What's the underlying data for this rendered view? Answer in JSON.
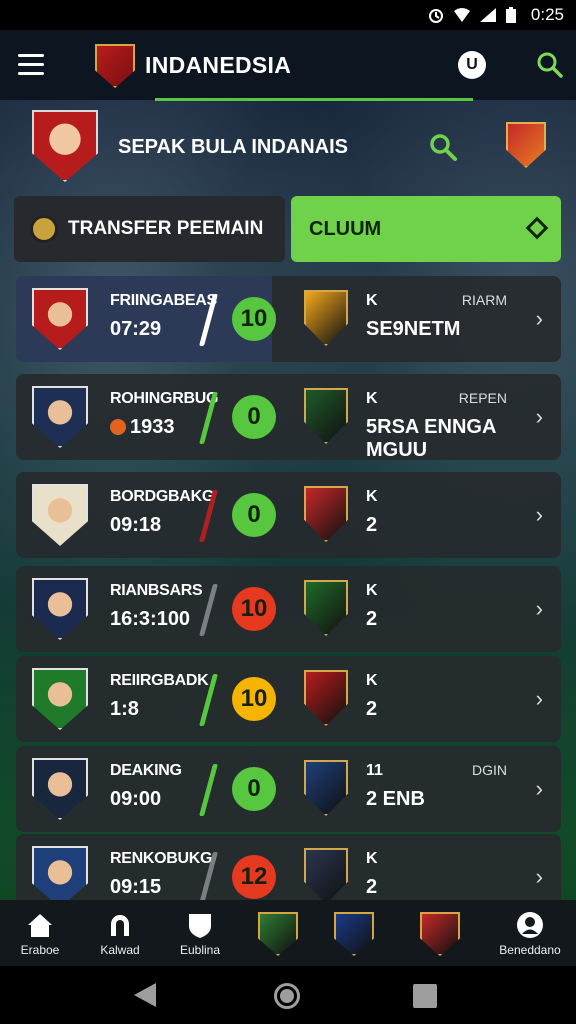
{
  "status": {
    "time": "0:25"
  },
  "appbar": {
    "title": "INDANEDSIA",
    "mic_label": "U"
  },
  "profile": {
    "name": "SEPAK BULA INDANAIS"
  },
  "tabs": [
    {
      "label": "TRANSFER PEEMAIN",
      "active": false
    },
    {
      "label": "CLUUM",
      "active": true
    }
  ],
  "colors": {
    "accent": "#6fd24a",
    "score_green": "#56c73e",
    "score_red": "#e53920",
    "score_yellow": "#f5b400"
  },
  "rows": [
    {
      "player": "FRIINGABEAS",
      "time": "07:29",
      "score": "10",
      "score_color": "#56c73e",
      "slash_color": "#ffffff",
      "k": "K",
      "value": "SE9NETM",
      "tag": "RIARM",
      "avatar_bg": "#b71c1c",
      "club_bg": "#f2a71b"
    },
    {
      "player": "ROHINGRBUG",
      "time": "1933",
      "has_dot": true,
      "score": "0",
      "score_color": "#56c73e",
      "slash_color": "#56c73e",
      "k": "K",
      "value": "5RSA ENNGA MGUU",
      "tag": "REPEN",
      "avatar_bg": "#1e2f55",
      "club_bg": "#1f5a2a"
    },
    {
      "player": "BORDGBAKG",
      "time": "09:18",
      "score": "0",
      "score_color": "#56c73e",
      "slash_color": "#b02020",
      "k": "K",
      "value": "2",
      "tag": "",
      "avatar_bg": "#e8e0c8",
      "club_bg": "#c62828"
    },
    {
      "player": "RIANBSARS",
      "time": "16:3:100",
      "score": "10",
      "score_color": "#e53920",
      "slash_color": "#7a7f84",
      "k": "K",
      "value": "2",
      "tag": "",
      "avatar_bg": "#1c2a50",
      "club_bg": "#1f6a2a"
    },
    {
      "player": "REIIRGBADK",
      "time": "1:8",
      "score": "10",
      "score_color": "#f5b400",
      "slash_color": "#56c73e",
      "k": "K",
      "value": "2",
      "tag": "",
      "avatar_bg": "#1f7a2a",
      "club_bg": "#b71c1c"
    },
    {
      "player": "DEAKING",
      "time": "09:00",
      "score": "0",
      "score_color": "#56c73e",
      "slash_color": "#56c73e",
      "k": "11",
      "value": "2 ENB",
      "tag": "DGIN",
      "avatar_bg": "#18263e",
      "club_bg": "#1f3f7a"
    },
    {
      "player": "RENKOBUKG",
      "time": "09:15",
      "score": "12",
      "score_color": "#e53920",
      "slash_color": "#7a7f84",
      "k": "K",
      "value": "2",
      "tag": "",
      "avatar_bg": "#1f3f7a",
      "club_bg": "#2a3550"
    }
  ],
  "nav": [
    {
      "label": "Eraboe",
      "icon": "home-icon"
    },
    {
      "label": "Kalwad",
      "icon": "headphones-icon"
    },
    {
      "label": "Eublina",
      "icon": "shield-icon"
    },
    {
      "label": "",
      "icon": "club-crest-icon"
    },
    {
      "label": "",
      "icon": "eagle-crest-icon"
    },
    {
      "label": "",
      "icon": "red-crest-icon"
    },
    {
      "label": "Beneddano",
      "icon": "profile-icon"
    }
  ]
}
